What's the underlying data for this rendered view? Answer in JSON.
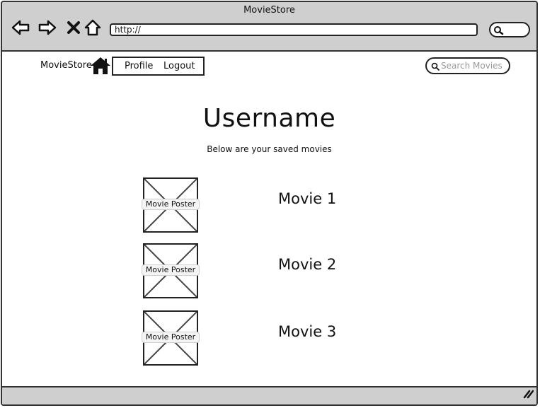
{
  "window": {
    "title": "MovieStore"
  },
  "browser": {
    "url": "http://",
    "icons": [
      "back-arrow-icon",
      "forward-arrow-icon",
      "close-icon",
      "home-outline-icon",
      "search-icon"
    ]
  },
  "nav": {
    "brand": "MovieStore",
    "home_icon": "home-icon",
    "links": [
      "Profile",
      "Logout"
    ],
    "search_placeholder": "Search Movies"
  },
  "main": {
    "title": "Username",
    "subtitle": "Below are your saved movies",
    "movies": [
      {
        "poster_label": "Movie Poster",
        "title": "Movie 1"
      },
      {
        "poster_label": "Movie Poster",
        "title": "Movie 2"
      },
      {
        "poster_label": "Movie Poster",
        "title": "Movie 3"
      }
    ]
  },
  "colors": {
    "chrome": "#cfcfcf",
    "stroke": "#222222",
    "placeholder": "#999999"
  }
}
